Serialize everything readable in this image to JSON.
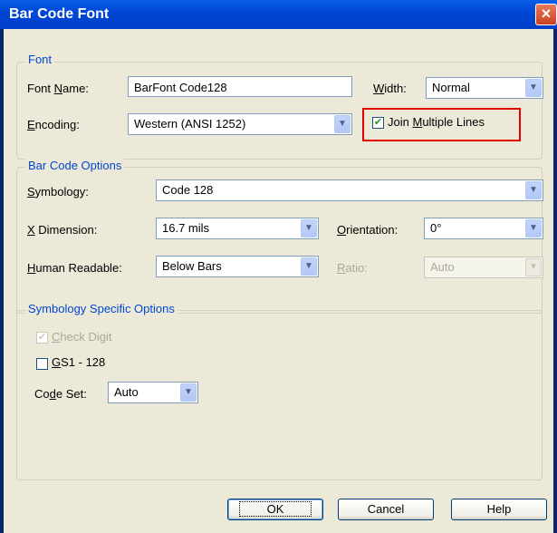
{
  "window": {
    "title": "Bar Code Font",
    "close_glyph": "×"
  },
  "font_group": {
    "label": "Font",
    "font_name_label": "Font Name:",
    "font_name_value": "BarFont Code128",
    "width_label": "Width:",
    "width_value": "Normal",
    "encoding_label": "Encoding:",
    "encoding_value": "Western (ANSI 1252)",
    "join_label": "Join Multiple Lines",
    "join_checked": true
  },
  "options_group": {
    "label": "Bar Code Options",
    "symbology_label": "Symbology:",
    "symbology_value": "Code 128",
    "xdim_label": "X Dimension:",
    "xdim_value": "16.7 mils",
    "orientation_label": "Orientation:",
    "orientation_value": "0°",
    "human_label": "Human Readable:",
    "human_value": "Below Bars",
    "ratio_label": "Ratio:",
    "ratio_value": "Auto"
  },
  "specific_group": {
    "label": "Symbology Specific Options",
    "check_digit_label": "Check Digit",
    "gs1_label": "GS1 - 128",
    "codeset_label": "Code Set:",
    "codeset_value": "Auto"
  },
  "buttons": {
    "ok": "OK",
    "cancel": "Cancel",
    "help": "Help"
  },
  "icons": {
    "dropdown": "chevron-down-icon",
    "check": "checkmark-icon"
  },
  "colors": {
    "group_label": "#0046d5",
    "highlight": "#e00000",
    "client_bg": "#ece9d8",
    "titlebar": "#0047d6"
  }
}
